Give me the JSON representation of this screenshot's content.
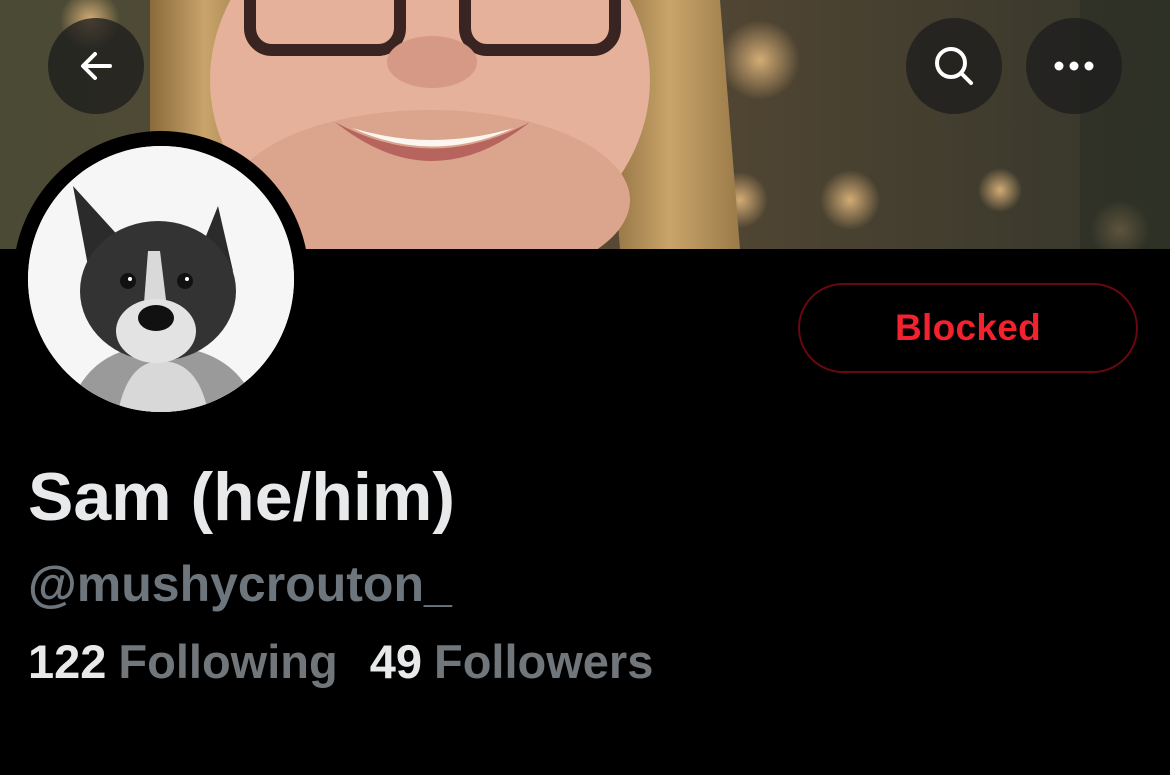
{
  "header": {
    "back_icon": "arrow-left-icon",
    "search_icon": "search-icon",
    "more_icon": "more-horizontal-icon"
  },
  "profile": {
    "display_name": "Sam (he/him)",
    "handle": "@mushycrouton_",
    "action_button_label": "Blocked",
    "following_count": "122",
    "following_label": "Following",
    "followers_count": "49",
    "followers_label": "Followers"
  },
  "colors": {
    "background": "#000000",
    "blocked_red": "#f4212e",
    "blocked_border": "#67070f",
    "primary_text": "#e7e9ea",
    "secondary_text": "#71767b"
  }
}
